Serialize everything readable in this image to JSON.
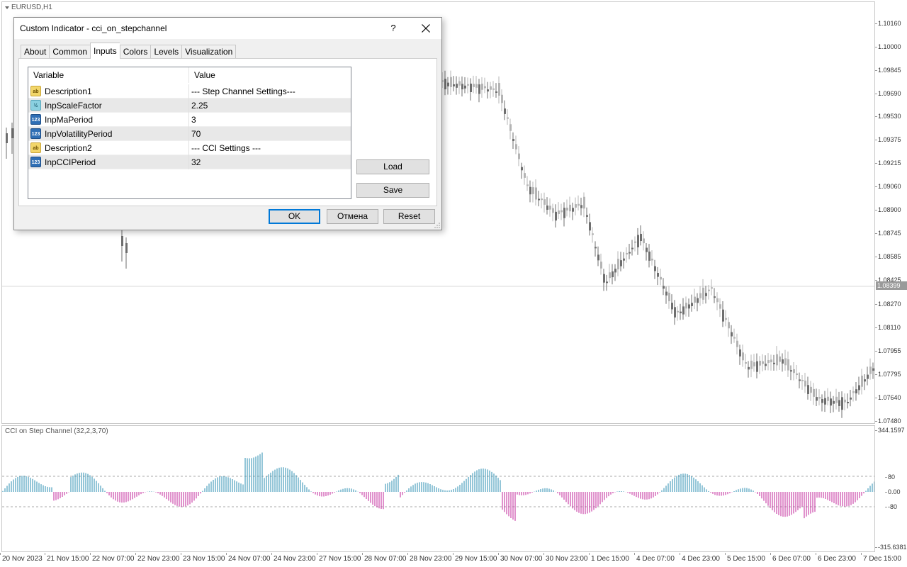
{
  "chart": {
    "symbol": "EURUSD,H1",
    "current_price": "1.08399",
    "price_ticks": [
      "1.10160",
      "1.10000",
      "1.09845",
      "1.09690",
      "1.09530",
      "1.09375",
      "1.09215",
      "1.09060",
      "1.08900",
      "1.08745",
      "1.08585",
      "1.08425",
      "1.08270",
      "1.08110",
      "1.07955",
      "1.07795",
      "1.07640",
      "1.07480"
    ],
    "indicator_title": "CCI on Step Channel (32,2,3,70)",
    "indicator_ticks": [
      "344.1597",
      "80",
      "0.00",
      "-80",
      "-315.6381"
    ],
    "time_labels": [
      "20 Nov 2023",
      "21 Nov 15:00",
      "22 Nov 07:00",
      "22 Nov 23:00",
      "23 Nov 15:00",
      "24 Nov 07:00",
      "24 Nov 23:00",
      "27 Nov 15:00",
      "28 Nov 07:00",
      "28 Nov 23:00",
      "29 Nov 15:00",
      "30 Nov 07:00",
      "30 Nov 23:00",
      "1 Dec 15:00",
      "4 Dec 07:00",
      "4 Dec 23:00",
      "5 Dec 15:00",
      "6 Dec 07:00",
      "6 Dec 23:00",
      "7 Dec 15:00"
    ],
    "colors": {
      "candle_bull": "#b4b4b4",
      "candle_bear": "#6e6e6e",
      "cci_pos": "#2a8db0",
      "cci_neg": "#c0239a"
    }
  },
  "dialog": {
    "title": "Custom Indicator - cci_on_stepchannel",
    "help_label": "?",
    "tabs": [
      {
        "label": "About"
      },
      {
        "label": "Common"
      },
      {
        "label": "Inputs",
        "active": true
      },
      {
        "label": "Colors"
      },
      {
        "label": "Levels"
      },
      {
        "label": "Visualization"
      }
    ],
    "table": {
      "col_variable": "Variable",
      "col_value": "Value",
      "rows": [
        {
          "type": "string",
          "type_icon": "ab",
          "name": "Description1",
          "value": "--- Step Channel Settings---"
        },
        {
          "type": "double",
          "type_icon": "½",
          "name": "InpScaleFactor",
          "value": "2.25"
        },
        {
          "type": "integer",
          "type_icon": "123",
          "name": "InpMaPeriod",
          "value": "3"
        },
        {
          "type": "integer",
          "type_icon": "123",
          "name": "InpVolatilityPeriod",
          "value": "70"
        },
        {
          "type": "string",
          "type_icon": "ab",
          "name": "Description2",
          "value": "--- CCI Settings ---"
        },
        {
          "type": "integer",
          "type_icon": "123",
          "name": "InpCCIPeriod",
          "value": "32"
        }
      ]
    },
    "load_label": "Load",
    "save_label": "Save",
    "ok_label": "OK",
    "cancel_label": "Отмена",
    "reset_label": "Reset"
  }
}
